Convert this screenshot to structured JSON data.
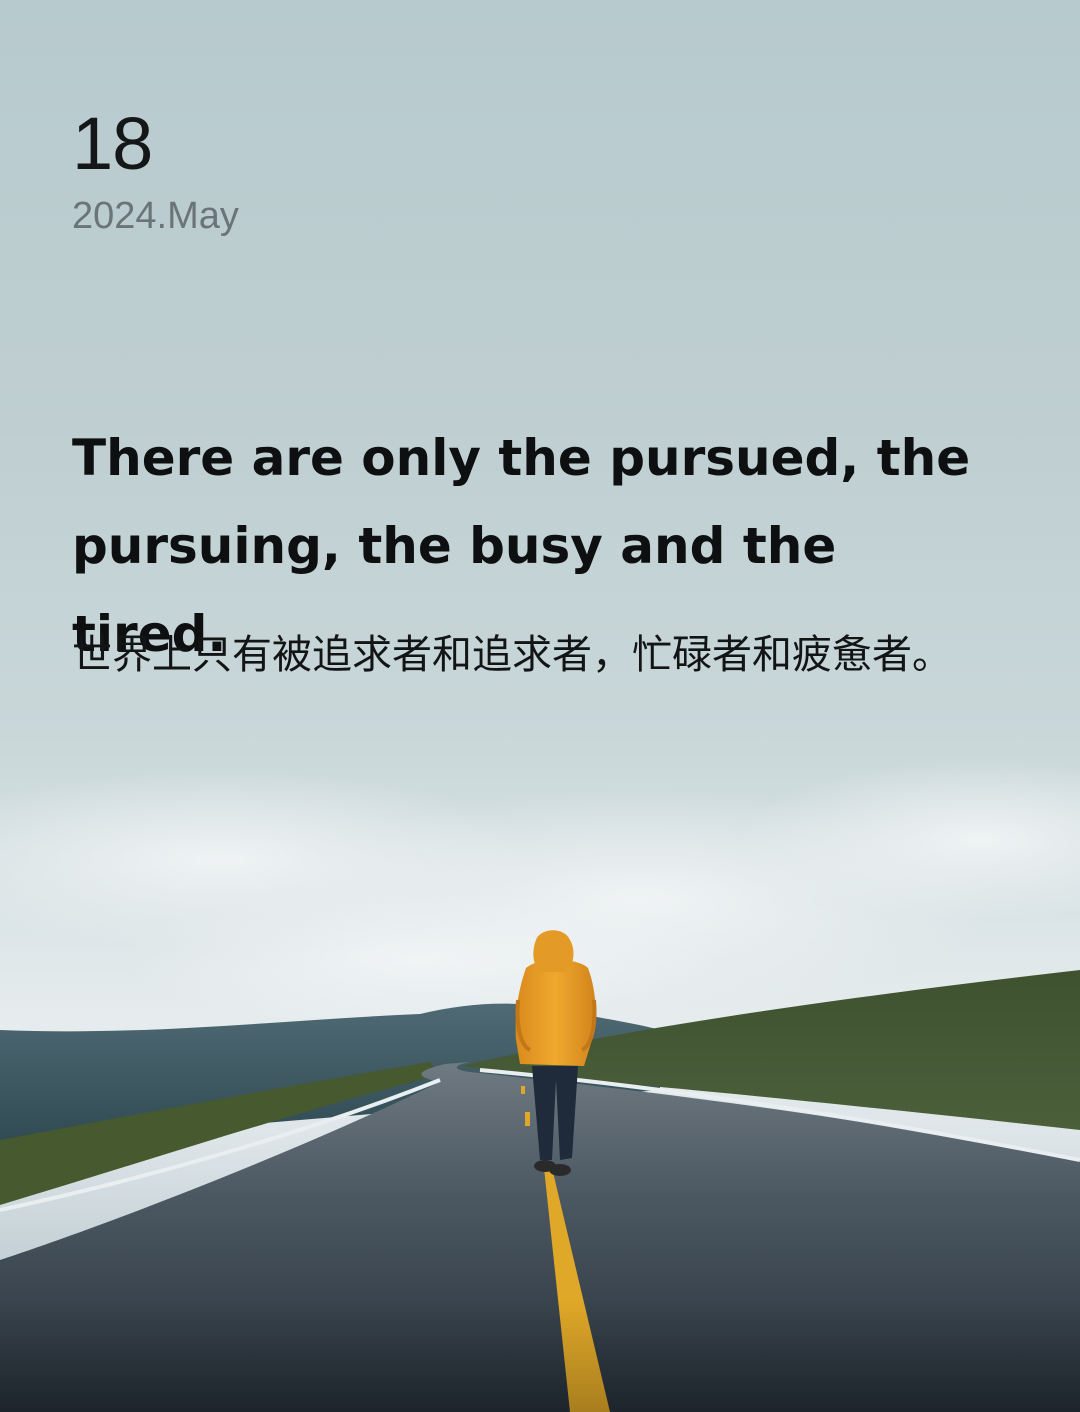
{
  "date": {
    "day": "18",
    "month_year": "2024.May"
  },
  "quote": {
    "english": "There are only the pursued, the pursuing, the busy and the tired.",
    "chinese": "世界上只有被追求者和追求者，忙碌者和疲惫者。"
  },
  "photo": {
    "subject": "person-in-yellow-raincoat-walking-on-road",
    "colors": {
      "sky": "#c9d7d9",
      "road": "#3b4650",
      "raincoat": "#e8a02c",
      "center_line": "#e0a828",
      "hills": "#4a5d3a"
    }
  }
}
